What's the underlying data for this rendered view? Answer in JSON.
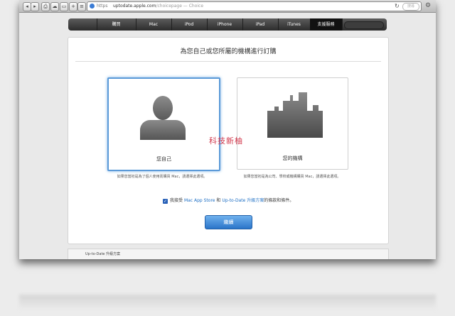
{
  "browser": {
    "address_scheme": "https",
    "address_host": "uptodate.apple.com",
    "address_path": "/choicepage — Choice",
    "search_placeholder": "搜尋"
  },
  "nav": {
    "apple": "",
    "items": [
      "購買",
      "Mac",
      "iPod",
      "iPhone",
      "iPad",
      "iTunes",
      "支援服務"
    ]
  },
  "page": {
    "title": "為您自己或您所屬的機構進行訂購",
    "cards": [
      {
        "label": "您自己",
        "desc": "如果您當初是為了個人使用而購買 Mac，請選擇此選項。",
        "selected": true
      },
      {
        "label": "您的機構",
        "desc": "如果您當初是為公司、學校或機構購買 Mac，請選擇此選項。",
        "selected": false
      }
    ],
    "agree_prefix": "我接受",
    "agree_link1": "Mac App Store",
    "agree_and": "和",
    "agree_link2": "Up-to-Date 升級方案",
    "agree_suffix": "的條款和條件。",
    "continue_label": "繼續"
  },
  "footer": {
    "crumb": "Up-to-Date 升級方案"
  },
  "watermark": "科技新柚"
}
